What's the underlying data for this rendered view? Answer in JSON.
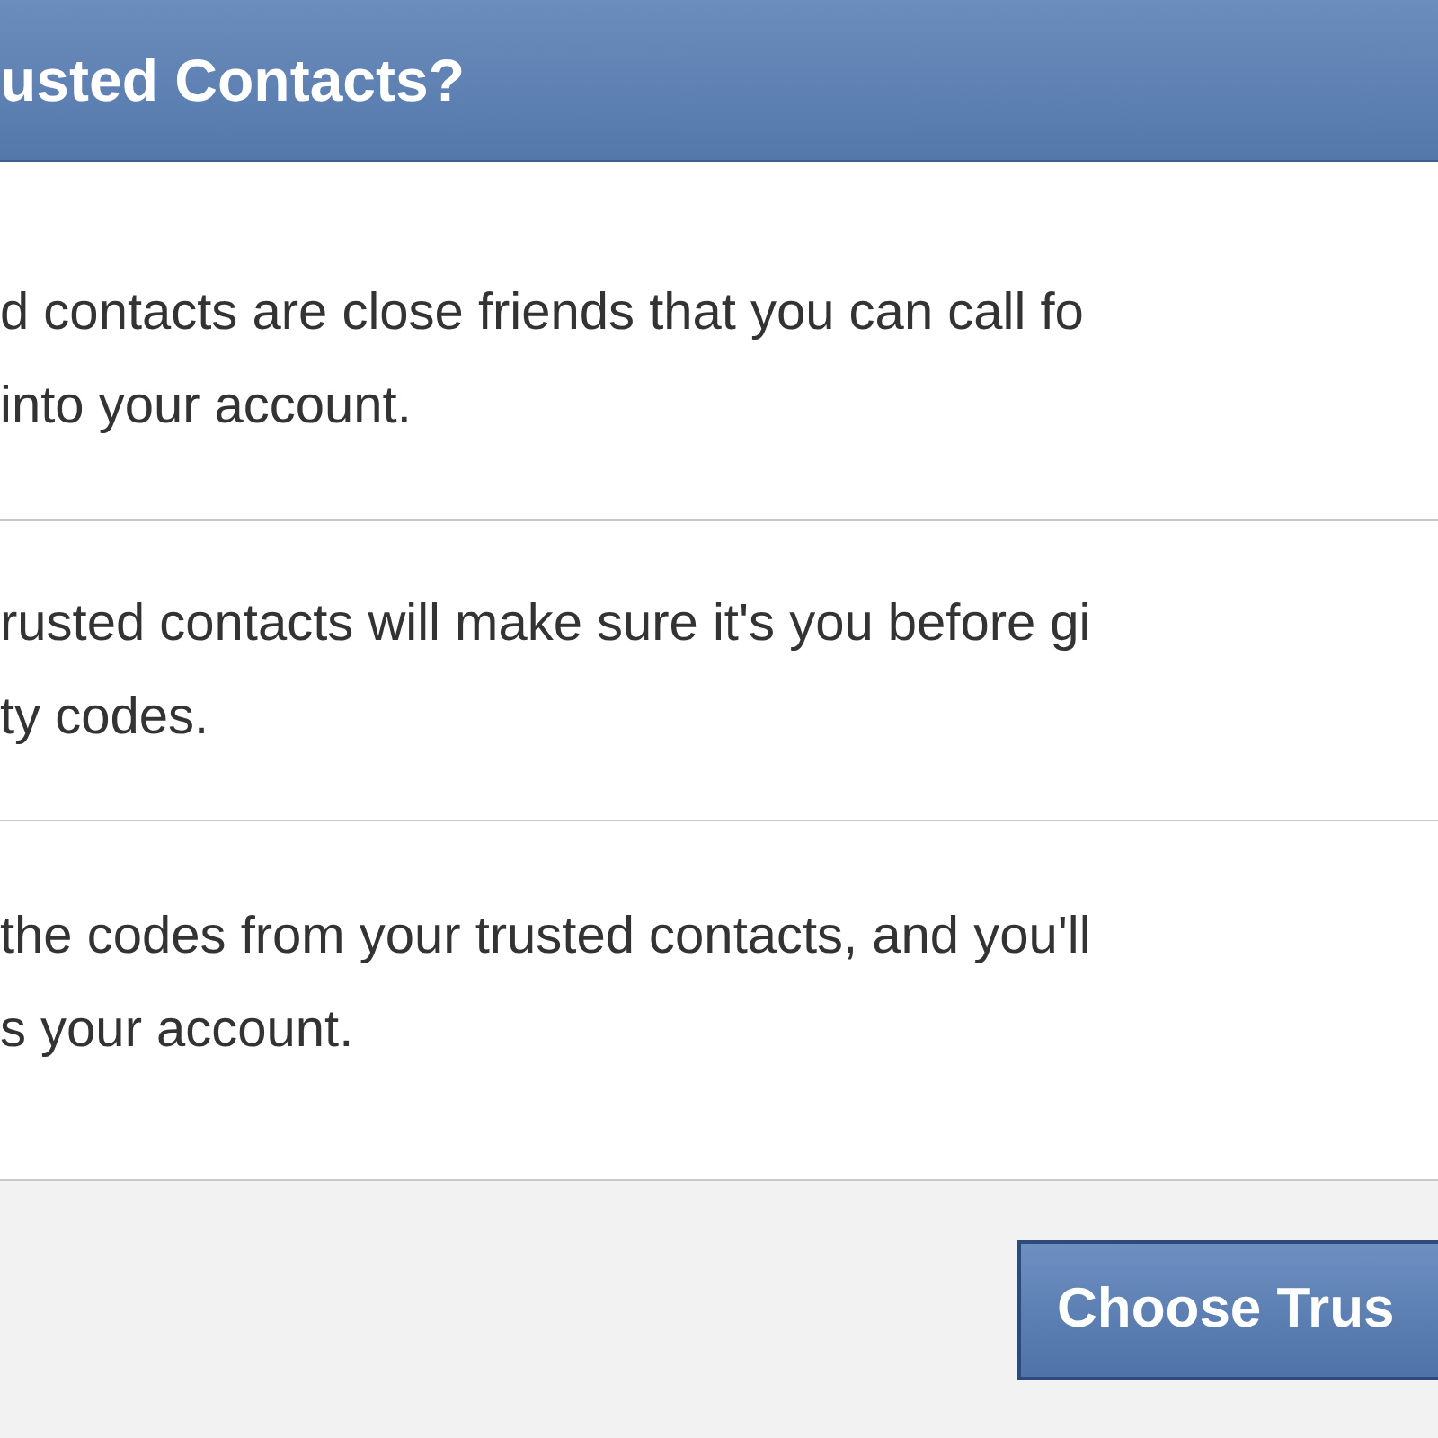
{
  "dialog": {
    "title": "usted Contacts?",
    "sections": [
      {
        "lines": [
          "d contacts are close friends that you can call fo",
          "into your account."
        ]
      },
      {
        "lines": [
          "rusted contacts will make sure it's you before gi",
          "ty codes."
        ]
      },
      {
        "lines": [
          "the codes from your trusted contacts, and you'll",
          "s your account."
        ]
      }
    ],
    "footer": {
      "button": "Choose Trus"
    }
  }
}
